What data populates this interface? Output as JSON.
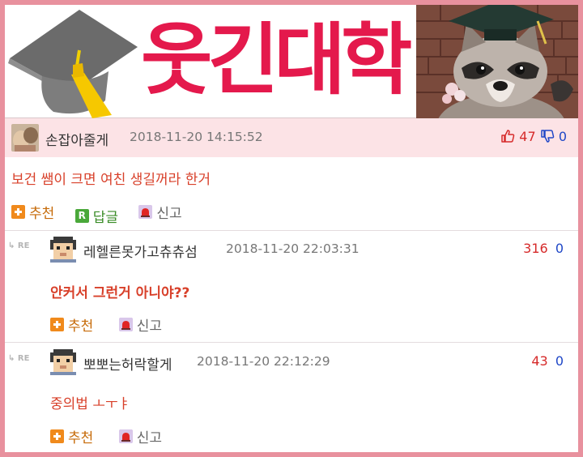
{
  "banner": {
    "logo_text": "웃긴대학"
  },
  "colors": {
    "frame": "#e8919e",
    "logo": "#e4194c",
    "highlight_bg": "#fce3e6",
    "comment_text": "#d8402a",
    "upvote": "#d62a2a",
    "downvote": "#1f47c7"
  },
  "comments": [
    {
      "nickname": "손잡아줄게",
      "datetime": "2018-11-20 14:15:52",
      "up": "47",
      "down": "0",
      "text": "보건 쌤이 크면 여친 생길꺼라 한거",
      "actions": {
        "recommend": "추천",
        "reply": "답글",
        "report": "신고"
      }
    }
  ],
  "replies": [
    {
      "re_label": "RE",
      "nickname": "레헬른못가고츄츄섬",
      "datetime": "2018-11-20 22:03:31",
      "up": "316",
      "down": "0",
      "text": "안커서 그런거 아니야??",
      "actions": {
        "recommend": "추천",
        "report": "신고"
      }
    },
    {
      "re_label": "RE",
      "nickname": "뽀뽀는허락할게",
      "datetime": "2018-11-20 22:12:29",
      "up": "43",
      "down": "0",
      "text": "중의법 ㅗㅜㅑ",
      "actions": {
        "recommend": "추천",
        "report": "신고"
      }
    }
  ],
  "icons": {
    "up": "thumbs-up-icon",
    "down": "thumbs-down-icon",
    "recommend": "plus-square-icon",
    "reply": "reply-r-icon",
    "report": "siren-icon",
    "re": "reply-arrow-icon"
  }
}
